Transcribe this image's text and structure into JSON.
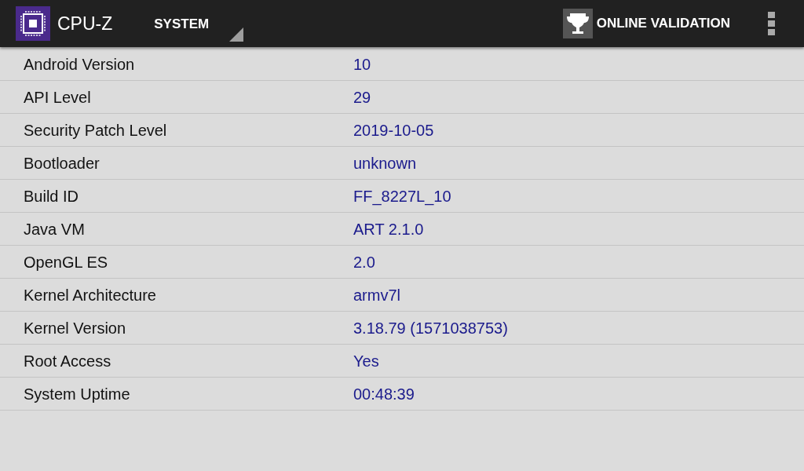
{
  "app_bar": {
    "title": "CPU-Z",
    "section_dropdown": "SYSTEM",
    "validation_button": "ONLINE VALIDATION"
  },
  "rows": [
    {
      "label": "Android Version",
      "value": "10"
    },
    {
      "label": "API Level",
      "value": "29"
    },
    {
      "label": "Security Patch Level",
      "value": "2019-10-05"
    },
    {
      "label": "Bootloader",
      "value": "unknown"
    },
    {
      "label": "Build ID",
      "value": "FF_8227L_10"
    },
    {
      "label": "Java VM",
      "value": "ART 2.1.0"
    },
    {
      "label": "OpenGL ES",
      "value": "2.0"
    },
    {
      "label": "Kernel Architecture",
      "value": "armv7l"
    },
    {
      "label": "Kernel Version",
      "value": "3.18.79 (1571038753)"
    },
    {
      "label": "Root Access",
      "value": "Yes"
    },
    {
      "label": "System Uptime",
      "value": "00:48:39"
    }
  ]
}
